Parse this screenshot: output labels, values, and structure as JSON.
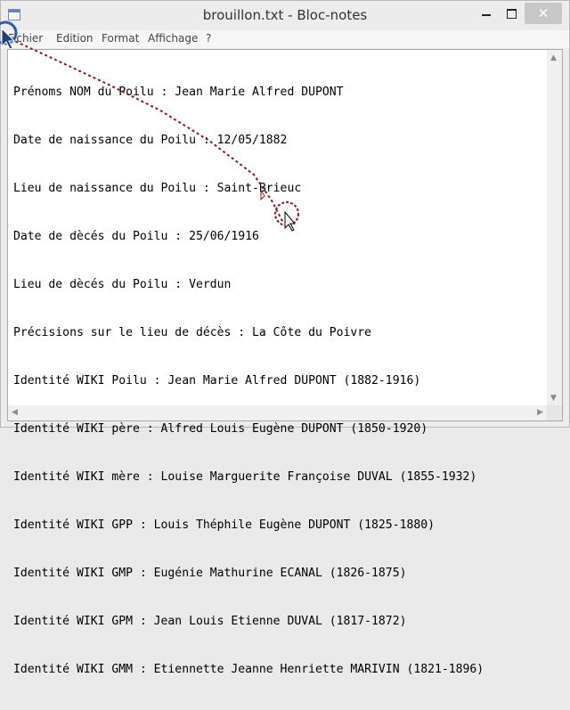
{
  "window": {
    "title": "brouillon.txt - Bloc-notes"
  },
  "controls": {
    "minimize": "",
    "maximize": "",
    "close": "✕"
  },
  "menu": [
    {
      "label": "Fichier"
    },
    {
      "label": "Edition"
    },
    {
      "label": "Format"
    },
    {
      "label": "Affichage"
    },
    {
      "label": "?"
    }
  ],
  "document": {
    "lines": [
      "Prénoms NOM du Poilu : Jean Marie Alfred DUPONT",
      "Date de naissance du Poilu : 12/05/1882",
      "Lieu de naissance du Poilu : Saint-Brieuc",
      "Date de dècés du Poilu : 25/06/1916",
      "Lieu de dècés du Poilu : Verdun",
      "Précisions sur le lieu de décès : La Côte du Poivre",
      "Identité WIKI Poilu : Jean Marie Alfred DUPONT (1882-1916)",
      "Identité WIKI père : Alfred Louis Eugène DUPONT (1850-1920)",
      "Identité WIKI mère : Louise Marguerite Françoise DUVAL (1855-1932)",
      "Identité WIKI GPP : Louis Théphile Eugène DUPONT (1825-1880)",
      "Identité WIKI GMP : Eugénie Mathurine ECANAL (1826-1875)",
      "Identité WIKI GPM : Jean Louis Etienne DUVAL (1817-1872)",
      "Identité WIKI GMM : Etiennette Jeanne Henriette MARIVIN (1821-1896)"
    ]
  },
  "scrollbars": {
    "up": "▲",
    "down": "▼",
    "left": "◀",
    "right": "▶"
  },
  "colors": {
    "cursor_trail": "#8b1a1a",
    "cursor_ring": "#2a5db0"
  }
}
